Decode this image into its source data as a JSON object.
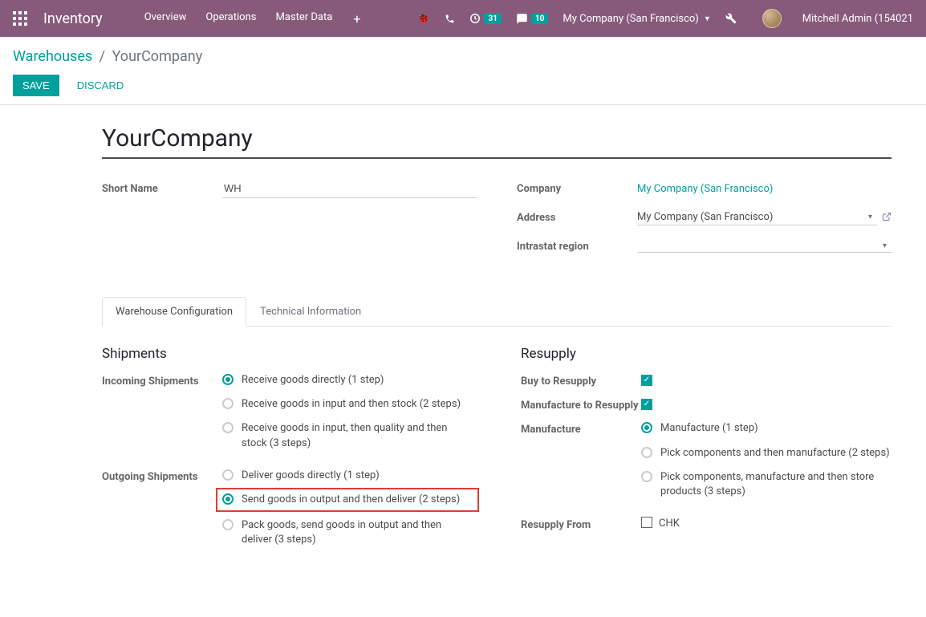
{
  "topnav": {
    "app_title": "Inventory",
    "links": [
      "Overview",
      "Operations",
      "Master Data"
    ],
    "activity_badge": "31",
    "discuss_badge": "10",
    "company": "My Company (San Francisco)",
    "user": "Mitchell Admin (154021"
  },
  "breadcrumb": {
    "root": "Warehouses",
    "current": "YourCompany"
  },
  "buttons": {
    "save": "Save",
    "discard": "Discard"
  },
  "form": {
    "title": "YourCompany",
    "short_name_label": "Short Name",
    "short_name_value": "WH",
    "company_label": "Company",
    "company_value": "My Company (San Francisco)",
    "address_label": "Address",
    "address_value": "My Company (San Francisco)",
    "intrastat_label": "Intrastat region",
    "intrastat_value": ""
  },
  "tabs": {
    "config": "Warehouse Configuration",
    "technical": "Technical Information"
  },
  "shipments": {
    "title": "Shipments",
    "incoming_label": "Incoming Shipments",
    "incoming_options": [
      "Receive goods directly (1 step)",
      "Receive goods in input and then stock (2 steps)",
      "Receive goods in input, then quality and then stock (3 steps)"
    ],
    "outgoing_label": "Outgoing Shipments",
    "outgoing_options": [
      "Deliver goods directly (1 step)",
      "Send goods in output and then deliver (2 steps)",
      "Pack goods, send goods in output and then deliver (3 steps)"
    ]
  },
  "resupply": {
    "title": "Resupply",
    "buy_label": "Buy to Resupply",
    "manuf_to_label": "Manufacture to Resupply",
    "manufacture_label": "Manufacture",
    "manufacture_options": [
      "Manufacture (1 step)",
      "Pick components and then manufacture (2 steps)",
      "Pick components, manufacture and then store products (3 steps)"
    ],
    "resupply_from_label": "Resupply From",
    "resupply_chk": "CHK"
  }
}
